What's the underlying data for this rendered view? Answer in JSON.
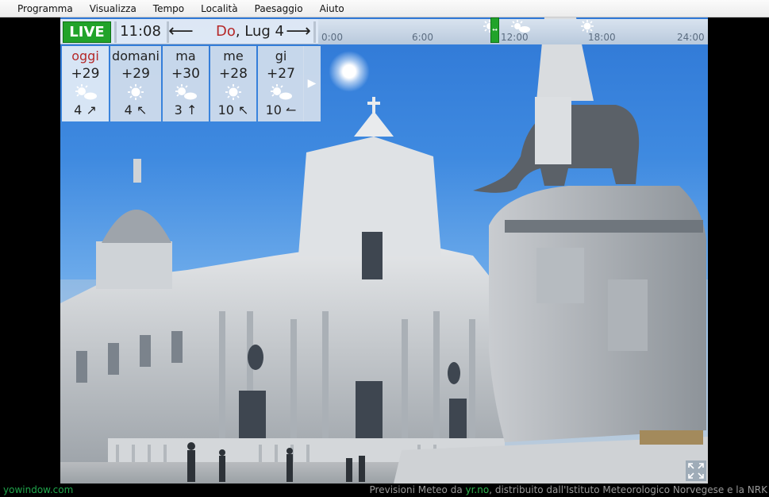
{
  "menu": [
    "Programma",
    "Visualizza",
    "Tempo",
    "Località",
    "Paesaggio",
    "Aiuto"
  ],
  "topbar": {
    "live_label": "LIVE",
    "time": "11:08",
    "prev_arrow": "⟵",
    "next_arrow": "⟶",
    "date_weekday": "Do",
    "date_rest": ", Lug 4"
  },
  "timeline": {
    "labels": [
      "0:00",
      "6:00",
      "12:00",
      "18:00",
      "24:00"
    ],
    "slider_glyph": "↔",
    "icons": [
      "sun-partly-cloudy-icon",
      "sun-partly-cloudy-icon",
      "sun-icon"
    ]
  },
  "forecast": [
    {
      "day": "oggi",
      "temp": "+29",
      "icon": "partly-cloudy",
      "wind": "4",
      "wind_arrow": "↗"
    },
    {
      "day": "domani",
      "temp": "+29",
      "icon": "sun",
      "wind": "4",
      "wind_arrow": "↖"
    },
    {
      "day": "ma",
      "temp": "+30",
      "icon": "partly-cloudy",
      "wind": "3",
      "wind_arrow": "↑"
    },
    {
      "day": "me",
      "temp": "+28",
      "icon": "sun",
      "wind": "10",
      "wind_arrow": "↖"
    },
    {
      "day": "gi",
      "temp": "+27",
      "icon": "partly-cloudy",
      "wind": "10",
      "wind_arrow": "↼"
    }
  ],
  "more_arrow": "▶",
  "footer": {
    "brand": "yowindow.com",
    "credit_prefix": "Previsioni Meteo da ",
    "credit_link": "yr.no",
    "credit_suffix": ", distribuito dall'Istituto Meteorologico Norvegese e la NRK"
  },
  "colors": {
    "live_green": "#21a32a",
    "today_red": "#b52828",
    "footer_green": "#1fa54b"
  }
}
